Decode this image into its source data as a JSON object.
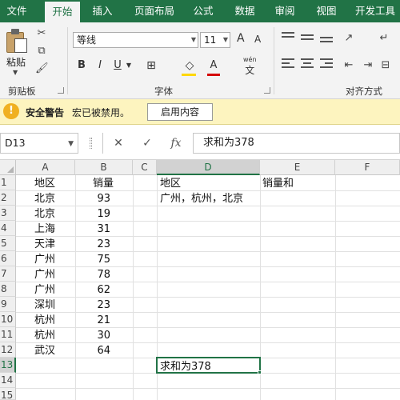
{
  "tabs": [
    {
      "label": "文件",
      "active": false
    },
    {
      "label": "开始",
      "active": true
    },
    {
      "label": "插入",
      "active": false
    },
    {
      "label": "页面布局",
      "active": false
    },
    {
      "label": "公式",
      "active": false
    },
    {
      "label": "数据",
      "active": false
    },
    {
      "label": "审阅",
      "active": false
    },
    {
      "label": "视图",
      "active": false
    },
    {
      "label": "开发工具",
      "active": false
    }
  ],
  "ribbon": {
    "clipboard": {
      "paste_label": "粘贴",
      "group_label": "剪贴板"
    },
    "font": {
      "font_name": "等线",
      "font_size": "11",
      "bold": "B",
      "italic": "I",
      "underline": "U",
      "grow": "A",
      "shrink": "A",
      "color_letter": "A",
      "wen": "wén",
      "wen_char": "文",
      "group_label": "字体",
      "font_color": "#d40000"
    },
    "alignment": {
      "group_label": "对齐方式"
    }
  },
  "security_bar": {
    "icon": "!",
    "title": "安全警告",
    "message": "宏已被禁用。",
    "button": "启用内容"
  },
  "formula_bar": {
    "name_box": "D13",
    "cancel": "✕",
    "enter": "✓",
    "fx": "fx",
    "content": "求和为378"
  },
  "sheet": {
    "columns": [
      "A",
      "B",
      "C",
      "D",
      "E",
      "F"
    ],
    "rows": [
      "1",
      "2",
      "3",
      "4",
      "5",
      "6",
      "7",
      "8",
      "9",
      "10",
      "11",
      "12",
      "13",
      "14",
      "15"
    ],
    "selected_column": "D",
    "selected_row": "13",
    "col_a": [
      "地区",
      "北京",
      "北京",
      "上海",
      "天津",
      "广州",
      "广州",
      "广州",
      "深圳",
      "杭州",
      "杭州",
      "武汉"
    ],
    "col_b": [
      "销量",
      "93",
      "19",
      "31",
      "23",
      "75",
      "78",
      "62",
      "23",
      "21",
      "30",
      "64"
    ],
    "d1": "地区",
    "e1": "销量和",
    "d2": "广州，杭州，北京",
    "d13": "求和为378"
  },
  "colors": {
    "accent": "#217346",
    "security_bar_bg": "#fdf4bf"
  }
}
